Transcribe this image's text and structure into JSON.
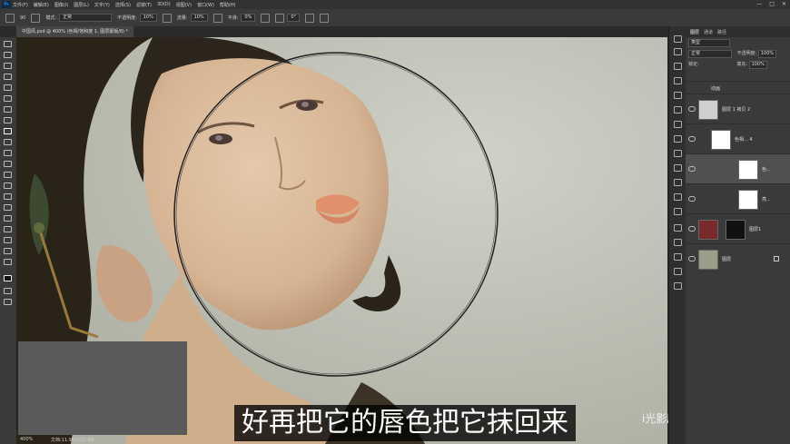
{
  "menu": {
    "app_icon": "Ps",
    "items": [
      "文件(F)",
      "编辑(E)",
      "图像(I)",
      "图层(L)",
      "文字(Y)",
      "选择(S)",
      "滤镜(T)",
      "3D(D)",
      "视图(V)",
      "窗口(W)",
      "帮助(H)"
    ],
    "window_controls": [
      "—",
      "□",
      "✕"
    ]
  },
  "options": {
    "brush_size": "90",
    "mode_label": "模式:",
    "mode_value": "正常",
    "opacity_label": "不透明度:",
    "opacity_value": "10%",
    "flow_label": "流量:",
    "flow_value": "10%",
    "smoothing_label": "平滑:",
    "smoothing_value": "0%",
    "angle_value": "0°"
  },
  "document": {
    "tab_title": "中国风.psd @ 400% (色相/饱和度 1, 图层蒙版/8) *",
    "zoom": "400%",
    "doc_size": "文档:11.9M/223.4M"
  },
  "subtitle": "好再把它的唇色把它抹回来",
  "watermark": {
    "channel": "i光影魔方",
    "logo": "bilibili"
  },
  "layers_panel": {
    "tabs": [
      "图层",
      "通道",
      "路径"
    ],
    "filter_label": "类型",
    "blend_mode": "正常",
    "opacity_label": "不透明度:",
    "opacity_value": "100%",
    "lock_label": "锁定:",
    "fill_label": "填充:",
    "fill_value": "100%",
    "layers": [
      {
        "name": "动画",
        "kind": "group"
      },
      {
        "name": "图层 1 拷贝 2",
        "kind": "pixel"
      },
      {
        "name": "色相... 4",
        "kind": "adjustment"
      },
      {
        "name": "色...",
        "kind": "adjustment"
      },
      {
        "name": "亮...",
        "kind": "adjustment"
      },
      {
        "name": "图层1",
        "kind": "pixel-mask"
      },
      {
        "name": "图层",
        "kind": "background"
      }
    ]
  },
  "colors": {
    "accent": "#31a8ff",
    "panel_bg": "#3a3a3a",
    "canvas_bg": "#c4c4b9"
  }
}
